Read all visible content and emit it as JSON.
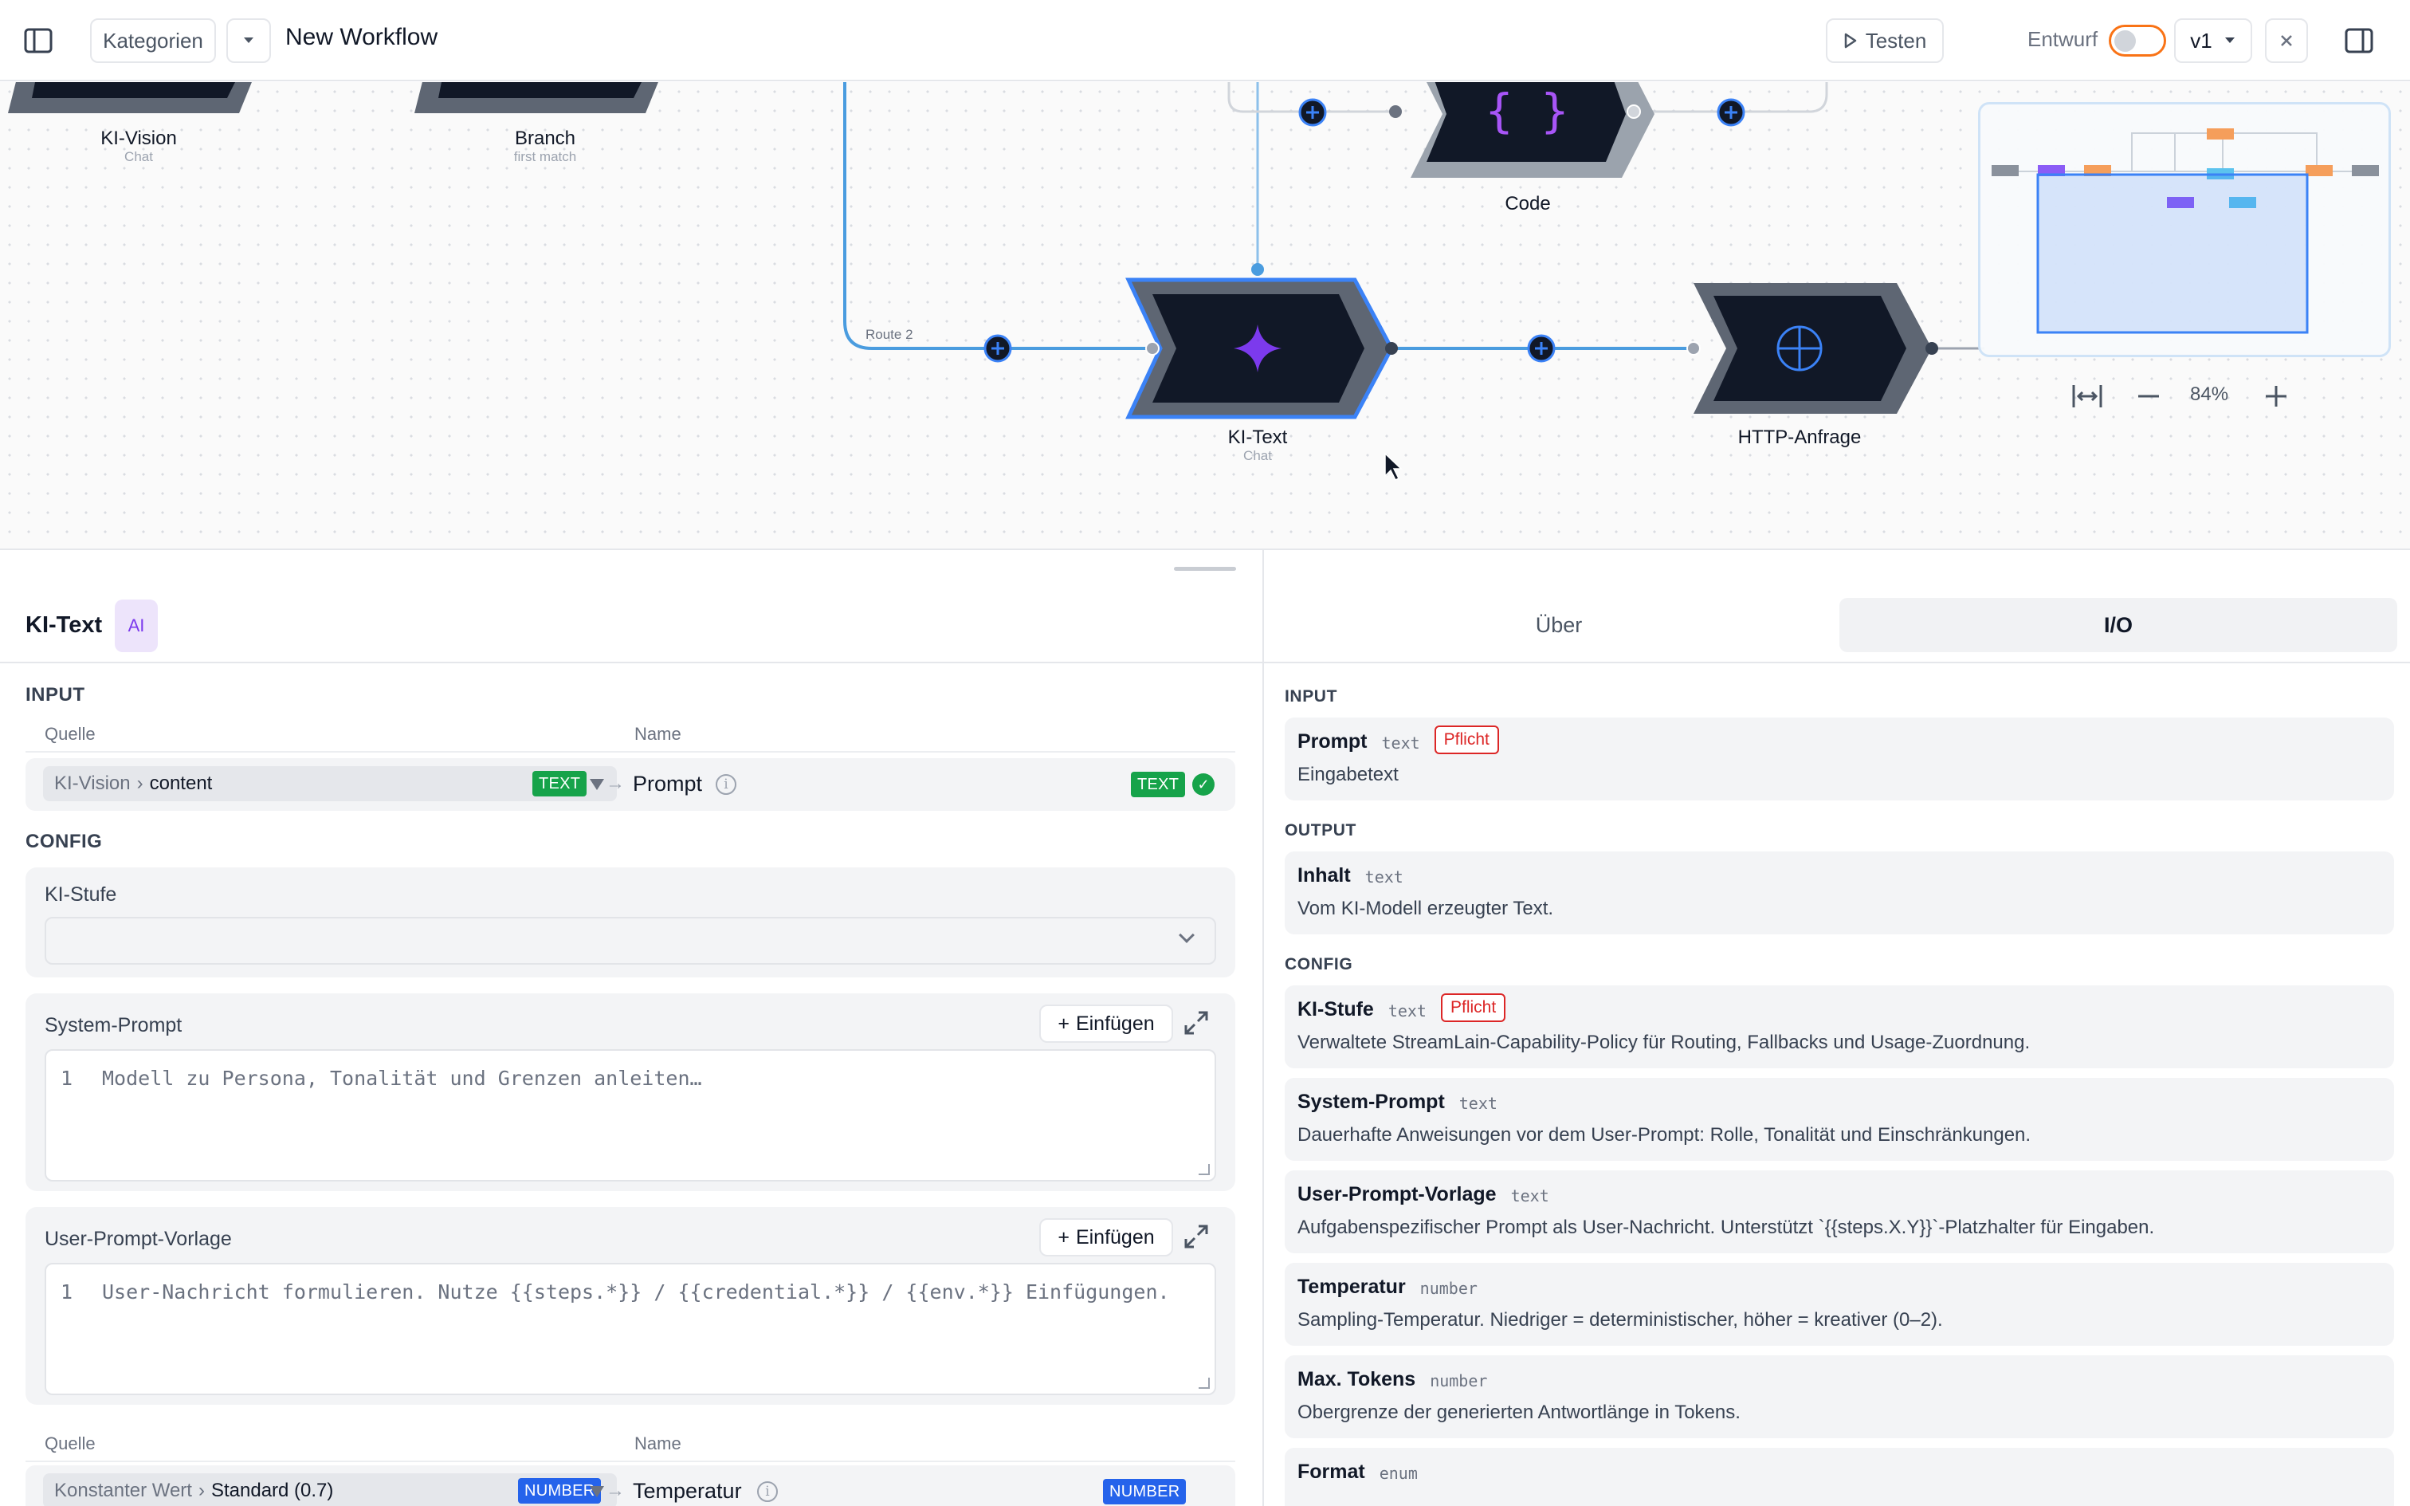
{
  "topbar": {
    "categories_label": "Kategorien",
    "workflow_title": "New Workflow",
    "test_label": "Testen",
    "status_label": "Entwurf",
    "version": "v1"
  },
  "canvas": {
    "nodes": [
      {
        "label": "KI-Vision",
        "sub": "Chat"
      },
      {
        "label": "Branch",
        "sub": "first match"
      },
      {
        "label": "Code",
        "sub": ""
      },
      {
        "label": "KI-Text",
        "sub": "Chat"
      },
      {
        "label": "HTTP-Anfrage",
        "sub": ""
      }
    ],
    "route_label": "Route 2",
    "zoom": "84%"
  },
  "colors": {
    "accent": "#3b82f6",
    "ai_purple": "#7c3aed",
    "code_purple": "#a855f7",
    "node_dark": "#101828",
    "success": "#16a34a",
    "danger": "#dc2626",
    "toggle_orange": "#f97316"
  },
  "left_panel": {
    "title": "KI-Text",
    "badge": "AI",
    "input_heading": "INPUT",
    "col_source": "Quelle",
    "col_name": "Name",
    "input_mapping": {
      "source_step": "KI-Vision",
      "source_sep": "›",
      "source_field": "content",
      "source_type": "TEXT",
      "target_name": "Prompt",
      "target_type": "TEXT"
    },
    "config_heading": "CONFIG",
    "ki_stufe_label": "KI-Stufe",
    "ki_stufe_value": "",
    "system_prompt_label": "System-Prompt",
    "insert_label": "Einfügen",
    "system_prompt_line": "1",
    "system_prompt_placeholder": "Modell zu Persona, Tonalität und Grenzen anleiten…",
    "user_prompt_label": "User-Prompt-Vorlage",
    "user_prompt_line": "1",
    "user_prompt_placeholder": "User-Nachricht formulieren. Nutze {{steps.*}} / {{credential.*}} / {{env.*}} Einfügungen.",
    "col_source_2": "Quelle",
    "col_name_2": "Name",
    "temp_mapping": {
      "source_step": "Konstanter Wert",
      "source_sep": "›",
      "source_field": "Standard (0.7)",
      "source_type": "NUMBER",
      "target_name": "Temperatur",
      "target_type": "NUMBER"
    }
  },
  "right_panel": {
    "tabs": [
      "Über",
      "I/O"
    ],
    "active_tab": "I/O",
    "input_heading": "INPUT",
    "output_heading": "OUTPUT",
    "config_heading": "CONFIG",
    "required_label": "Pflicht",
    "inputs": [
      {
        "name": "Prompt",
        "type": "text",
        "required": true,
        "desc": "Eingabetext"
      }
    ],
    "outputs": [
      {
        "name": "Inhalt",
        "type": "text",
        "required": false,
        "desc": "Vom KI-Modell erzeugter Text."
      }
    ],
    "config": [
      {
        "name": "KI-Stufe",
        "type": "text",
        "required": true,
        "desc": "Verwaltete StreamLain-Capability-Policy für Routing, Fallbacks und Usage-Zuordnung."
      },
      {
        "name": "System-Prompt",
        "type": "text",
        "required": false,
        "desc": "Dauerhafte Anweisungen vor dem User-Prompt: Rolle, Tonalität und Einschränkungen."
      },
      {
        "name": "User-Prompt-Vorlage",
        "type": "text",
        "required": false,
        "desc": "Aufgabenspezifischer Prompt als User-Nachricht. Unterstützt `{{steps.X.Y}}`-Platzhalter für Eingaben."
      },
      {
        "name": "Temperatur",
        "type": "number",
        "required": false,
        "desc": "Sampling-Temperatur. Niedriger = deterministischer, höher = kreativer (0–2)."
      },
      {
        "name": "Max. Tokens",
        "type": "number",
        "required": false,
        "desc": "Obergrenze der generierten Antwortlänge in Tokens."
      },
      {
        "name": "Format",
        "type": "enum",
        "required": false,
        "desc": ""
      }
    ]
  }
}
